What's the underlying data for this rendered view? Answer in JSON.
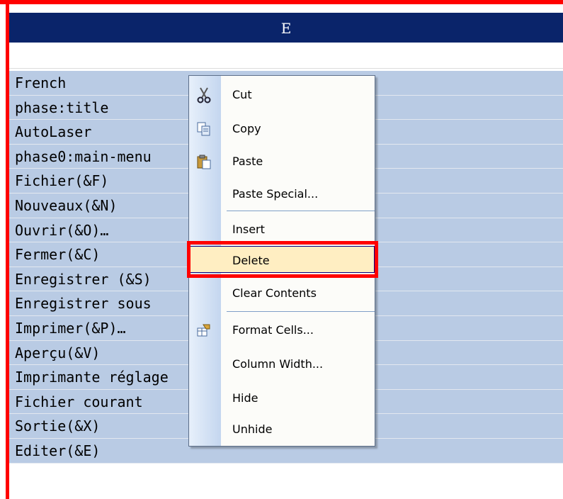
{
  "column_header": {
    "label": "E"
  },
  "rows": [
    "French",
    "phase:title",
    "AutoLaser",
    "phase0:main-menu",
    "Fichier(&F)",
    "Nouveaux(&N)",
    "Ouvrir(&O)…",
    "Fermer(&C)",
    "Enregistrer (&S)",
    "Enregistrer sous",
    "Imprimer(&P)…",
    "Aperçu(&V)",
    "Imprimante réglage",
    "Fichier courant",
    "Sortie(&X)",
    "Editer(&E)"
  ],
  "context_menu": {
    "items": [
      {
        "label": "Cut",
        "icon": "scissors-icon"
      },
      {
        "label": "Copy",
        "icon": "copy-icon"
      },
      {
        "label": "Paste",
        "icon": "paste-icon"
      },
      {
        "label": "Paste Special...",
        "icon": ""
      },
      {
        "label": "Insert",
        "icon": ""
      },
      {
        "label": "Delete",
        "icon": "",
        "highlighted": true
      },
      {
        "label": "Clear Contents",
        "icon": ""
      },
      {
        "label": "Format Cells...",
        "icon": "format-cells-icon"
      },
      {
        "label": "Column Width...",
        "icon": ""
      },
      {
        "label": "Hide",
        "icon": ""
      },
      {
        "label": "Unhide",
        "icon": ""
      }
    ]
  },
  "colors": {
    "header_bg": "#0a246a",
    "selection_bg": "#b9cbe4",
    "highlight_bg": "#ffeec2",
    "annotation_red": "#ff0000"
  }
}
